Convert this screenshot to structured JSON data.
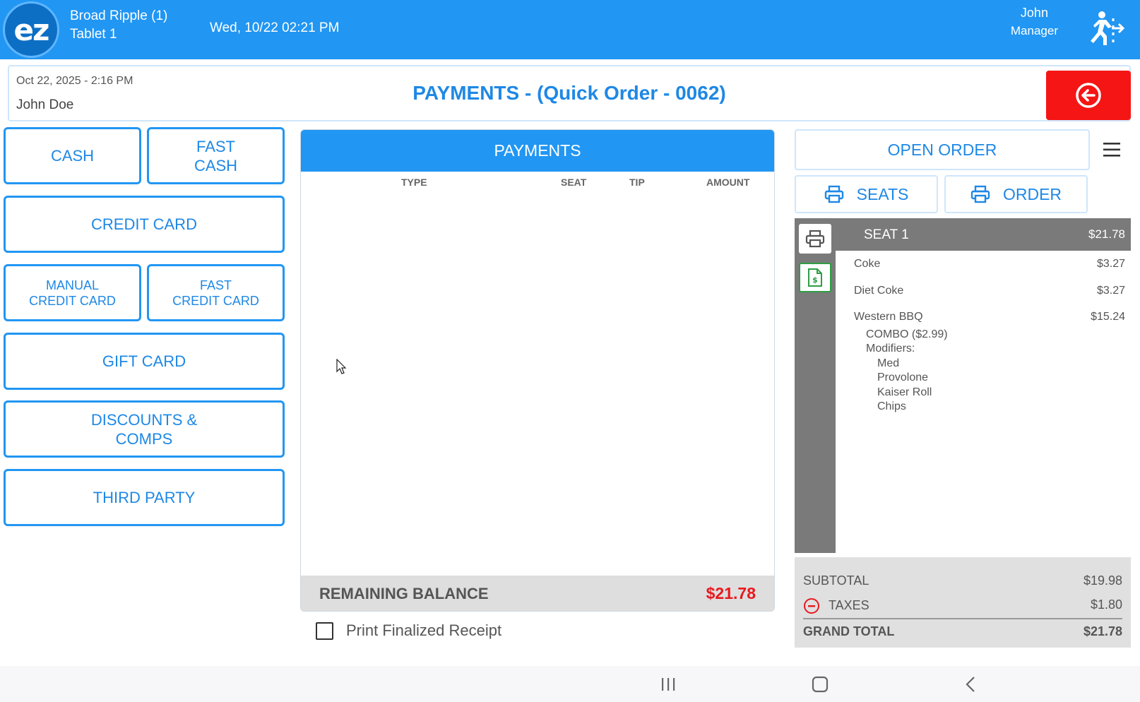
{
  "topbar": {
    "logo_text": "ez",
    "store_name": "Broad Ripple (1)",
    "device": "Tablet 1",
    "datetime": "Wed, 10/22 02:21 PM",
    "user_name": "John",
    "user_role": "Manager",
    "logout_icon": "exit-running-icon"
  },
  "order_header": {
    "date": "Oct 22, 2025  - 2:16 PM",
    "customer": "John Doe",
    "title": "PAYMENTS - (Quick Order - 0062)",
    "back_icon": "back-arrow-circle-icon"
  },
  "payment_methods": {
    "cash": "CASH",
    "fast_cash": "FAST\nCASH",
    "credit_card": "CREDIT CARD",
    "manual_credit_card": "MANUAL\nCREDIT CARD",
    "fast_credit_card": "FAST\nCREDIT CARD",
    "gift_card": "GIFT CARD",
    "discounts": "DISCOUNTS &\nCOMPS",
    "third_party": "THIRD PARTY"
  },
  "payments": {
    "title": "PAYMENTS",
    "columns": [
      "TYPE",
      "SEAT",
      "TIP",
      "AMOUNT"
    ],
    "rows": [],
    "remaining_label": "REMAINING BALANCE",
    "remaining_value": "$21.78",
    "print_receipt_label": "Print Finalized Receipt",
    "print_receipt_checked": false
  },
  "order_actions": {
    "open_order": "OPEN ORDER",
    "print_seats": "SEATS",
    "print_order": "ORDER",
    "menu_icon": "hamburger-menu-icon"
  },
  "seat": {
    "name": "SEAT 1",
    "total": "$21.78",
    "items": [
      {
        "name": "Coke",
        "price": "$3.27"
      },
      {
        "name": "Diet Coke",
        "price": "$3.27"
      },
      {
        "name": "Western BBQ",
        "price": "$15.24"
      }
    ],
    "combo_line": "COMBO  ($2.99)",
    "modifiers_label": "Modifiers:",
    "modifiers": [
      "Med",
      "Provolone",
      "Kaiser Roll",
      "Chips"
    ]
  },
  "totals": {
    "subtotal_label": "SUBTOTAL",
    "subtotal": "$19.98",
    "taxes_label": "TAXES",
    "taxes": "$1.80",
    "grand_label": "GRAND TOTAL",
    "grand": "$21.78"
  },
  "colors": {
    "primary": "#2196f3",
    "danger": "#f51515",
    "balance_red": "#e8191e",
    "seat_gray": "#7a7a7a"
  }
}
